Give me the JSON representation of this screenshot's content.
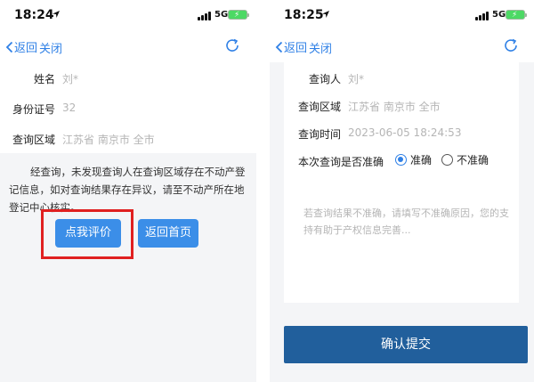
{
  "left": {
    "status": {
      "time": "18:24",
      "network": "5G"
    },
    "nav": {
      "back_label": "返回",
      "close_label": "关闭"
    },
    "fields": [
      {
        "label": "姓名",
        "value": "刘*"
      },
      {
        "label": "身份证号",
        "value": "32"
      },
      {
        "label": "查询区域",
        "value": "江苏省 南京市 全市"
      }
    ],
    "message": "经查询，未发现查询人在查询区域存在不动产登记信息，如对查询结果存在异议，请至不动产所在地登记中心核实。",
    "buttons": {
      "rate_label": "点我评价",
      "home_label": "返回首页"
    }
  },
  "right": {
    "status": {
      "time": "18:25",
      "network": "5G"
    },
    "nav": {
      "back_label": "返回",
      "close_label": "关闭"
    },
    "fields": [
      {
        "label": "查询人",
        "value": "刘*"
      },
      {
        "label": "查询区域",
        "value": "江苏省 南京市 全市"
      },
      {
        "label": "查询时间",
        "value": "2023-06-05 18:24:53"
      }
    ],
    "accuracy": {
      "label": "本次查询是否准确",
      "option_yes": "准确",
      "option_no": "不准确",
      "selected": "准确"
    },
    "reason_placeholder": "若查询结果不准确，请填写不准确原因，您的支持有助于产权信息完善...",
    "submit_label": "确认提交"
  },
  "colors": {
    "accent": "#2f80e6",
    "button": "#3b8ee8",
    "submit": "#215f9c",
    "highlight": "#e02020",
    "battery": "#4cd964"
  }
}
